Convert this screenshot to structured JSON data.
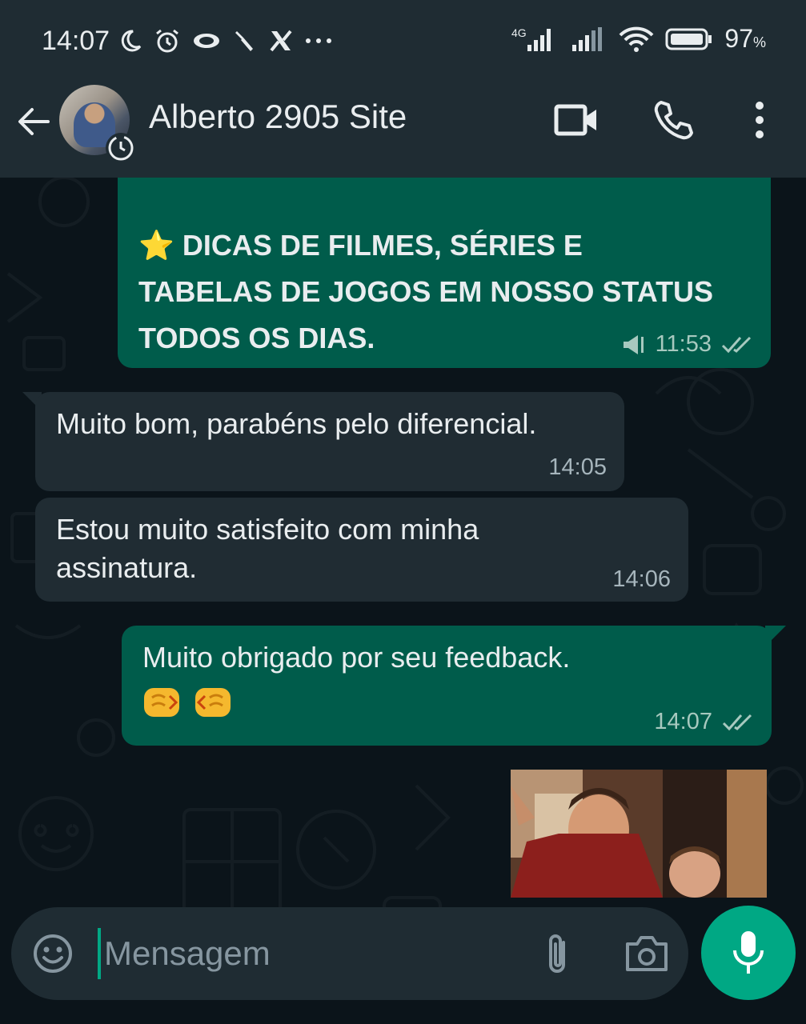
{
  "status_bar": {
    "time": "14:07",
    "network": "4G",
    "battery": "97",
    "battery_unit": "%"
  },
  "header": {
    "contact_name": "Alberto 2905 Site"
  },
  "messages": [
    {
      "direction": "out",
      "text_line1": "DICAS DE FILMES, SÉRIES E",
      "text_line2": "TABELAS DE JOGOS EM NOSSO STATUS",
      "text_line3": "TODOS OS DIAS.",
      "time": "11:53",
      "emoji": "⭐"
    },
    {
      "direction": "in",
      "text": "Muito bom, parabéns pelo diferencial.",
      "time": "14:05"
    },
    {
      "direction": "in",
      "text_line1": "Estou muito satisfeito com minha",
      "text_line2": "assinatura.",
      "time": "14:06"
    },
    {
      "direction": "out",
      "text": "Muito obrigado por seu feedback.",
      "emoji": "🤜🤛",
      "time": "14:07"
    }
  ],
  "input": {
    "placeholder": "Mensagem"
  },
  "colors": {
    "outgoing_bubble": "#005c4b",
    "incoming_bubble": "#202c33",
    "accent": "#00a884"
  }
}
